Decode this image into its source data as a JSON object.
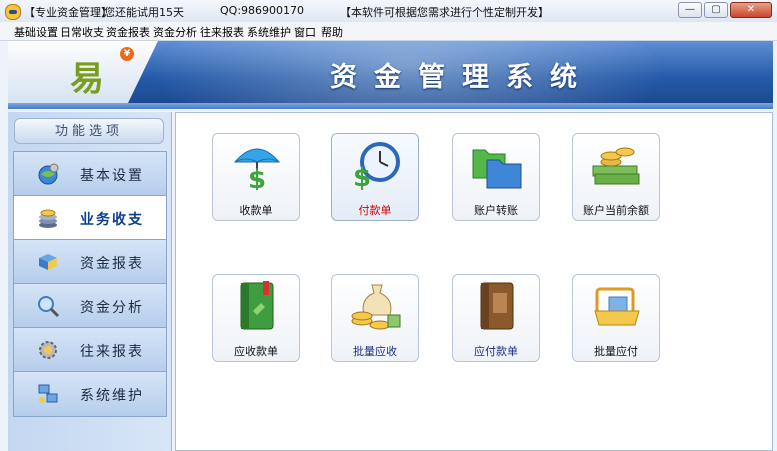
{
  "window": {
    "title_app": "【专业资金管理】",
    "title_trial": "您还能试用15天",
    "title_qq": "QQ:986900170",
    "title_custom": "【本软件可根据您需求进行个性定制开发】",
    "controls": [
      "minimize",
      "maximize",
      "close"
    ]
  },
  "menu": [
    "基础设置",
    "日常收支",
    "资金报表",
    "资金分析",
    "往来报表",
    "系统维护",
    "窗口",
    "帮助"
  ],
  "banner": {
    "logo_char": "易",
    "logo_coin": "¥",
    "title": "资金管理系统"
  },
  "sidebar": {
    "header": "功能选项",
    "items": [
      {
        "label": "基本设置",
        "icon": "settings-globe-icon",
        "active": false
      },
      {
        "label": "业务收支",
        "icon": "coin-stack-icon",
        "active": true
      },
      {
        "label": "资金报表",
        "icon": "report-book-icon",
        "active": false
      },
      {
        "label": "资金分析",
        "icon": "magnifier-icon",
        "active": false
      },
      {
        "label": "往来报表",
        "icon": "gear-chart-icon",
        "active": false
      },
      {
        "label": "系统维护",
        "icon": "network-computer-icon",
        "active": false
      }
    ]
  },
  "tiles": [
    {
      "label": "收款单",
      "icon": "umbrella-dollar-icon",
      "color": "normal"
    },
    {
      "label": "付款单",
      "icon": "clock-dollar-icon",
      "color": "red"
    },
    {
      "label": "账户转账",
      "icon": "folders-icon",
      "color": "normal"
    },
    {
      "label": "账户当前余额",
      "icon": "cash-coins-icon",
      "color": "normal"
    },
    {
      "label": "应收款单",
      "icon": "green-ledger-icon",
      "color": "normal"
    },
    {
      "label": "批量应收",
      "icon": "money-bag-coins-icon",
      "color": "blue"
    },
    {
      "label": "应付款单",
      "icon": "brown-ledger-icon",
      "color": "blue"
    },
    {
      "label": "批量应付",
      "icon": "wallet-card-icon",
      "color": "normal"
    }
  ]
}
